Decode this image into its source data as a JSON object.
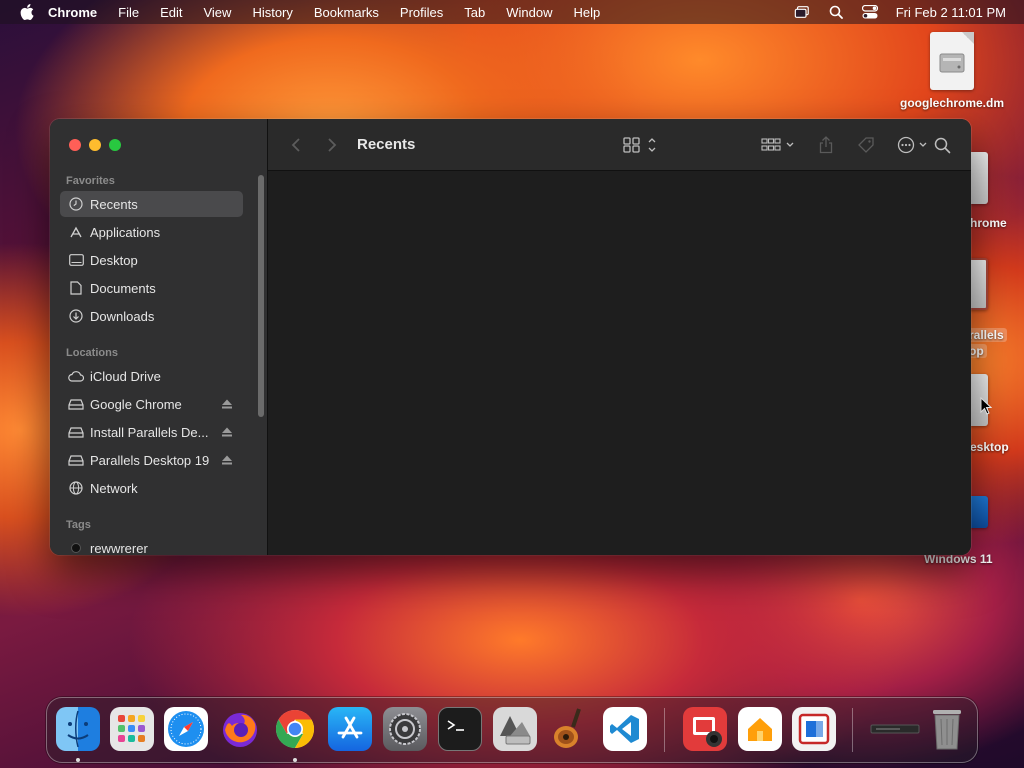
{
  "menubar": {
    "app_name": "Chrome",
    "items": [
      "File",
      "Edit",
      "View",
      "History",
      "Bookmarks",
      "Profiles",
      "Tab",
      "Window",
      "Help"
    ],
    "clock": "Fri Feb 2  11:01 PM"
  },
  "desktop": {
    "icons": [
      {
        "label": "googlechrome.dm",
        "icon": "dmg-file-icon"
      },
      {
        "label": "hrome",
        "icon": "drive-icon"
      },
      {
        "label": "rallels",
        "label2": "op",
        "icon": "drive-icon"
      },
      {
        "label": "esktop",
        "icon": "drive-icon"
      },
      {
        "label": "Windows 11",
        "icon": "vm-icon"
      }
    ]
  },
  "finder": {
    "title": "Recents",
    "sidebar": {
      "favorites_title": "Favorites",
      "favorites": [
        {
          "label": "Recents",
          "icon": "clock-icon",
          "selected": true
        },
        {
          "label": "Applications",
          "icon": "applications-icon"
        },
        {
          "label": "Desktop",
          "icon": "desktop-icon"
        },
        {
          "label": "Documents",
          "icon": "document-icon"
        },
        {
          "label": "Downloads",
          "icon": "download-icon"
        }
      ],
      "locations_title": "Locations",
      "locations": [
        {
          "label": "iCloud Drive",
          "icon": "cloud-icon"
        },
        {
          "label": "Google Chrome",
          "icon": "disk-icon",
          "eject": true
        },
        {
          "label": "Install Parallels De...",
          "icon": "disk-icon",
          "eject": true
        },
        {
          "label": "Parallels Desktop 19",
          "icon": "disk-icon",
          "eject": true
        },
        {
          "label": "Network",
          "icon": "globe-icon"
        }
      ],
      "tags_title": "Tags",
      "tags": [
        {
          "label": "rewwrerer",
          "color": "#111111"
        }
      ]
    }
  },
  "dock": {
    "apps": [
      "finder",
      "launchpad",
      "safari",
      "firefox",
      "chrome",
      "app-store",
      "system-settings",
      "terminal",
      "boot-camp-assistant",
      "garageband",
      "vscode",
      "photo-booth",
      "home",
      "parallels",
      "screenshot-thumbnail",
      "trash"
    ]
  },
  "colors": {
    "traffic_red": "#ff5f57",
    "traffic_yellow": "#febc2e",
    "traffic_green": "#28c840",
    "sidebar_bg": "#303031",
    "content_bg": "#1e1e1e"
  }
}
